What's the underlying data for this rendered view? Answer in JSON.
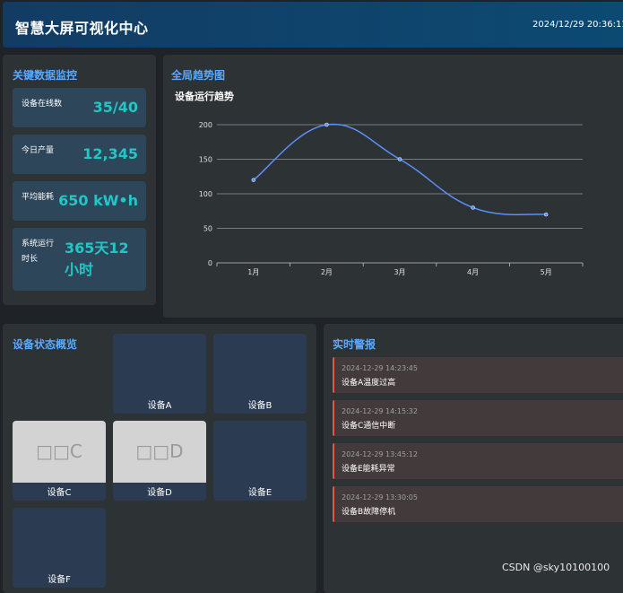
{
  "header": {
    "title": "智慧大屏可视化中心",
    "datetime": "2024/12/29 20:36:11"
  },
  "kpi": {
    "title": "关键数据监控",
    "items": [
      {
        "label": "设备在线数",
        "value": "35/40"
      },
      {
        "label": "今日产量",
        "value": "12,345"
      },
      {
        "label": "平均能耗",
        "value": "650 kW•h"
      },
      {
        "label": "系统运行时长",
        "value": "365天12小时"
      }
    ]
  },
  "trend": {
    "title": "全局趋势图",
    "chart_data": {
      "type": "line",
      "title": "设备运行趋势",
      "categories": [
        "1月",
        "2月",
        "3月",
        "4月",
        "5月"
      ],
      "values": [
        120,
        200,
        150,
        80,
        70
      ],
      "y_ticks": [
        "0",
        "50",
        "100",
        "150",
        "200"
      ],
      "ylim": [
        0,
        200
      ],
      "grid": true,
      "line_color": "#5b8ff9"
    }
  },
  "devices": {
    "title": "设备状态概览",
    "items": [
      {
        "name": "设备A",
        "thumb_text": ""
      },
      {
        "name": "设备B",
        "thumb_text": ""
      },
      {
        "name": "设备C",
        "thumb_text": "□□C"
      },
      {
        "name": "设备D",
        "thumb_text": "□□D"
      },
      {
        "name": "设备E",
        "thumb_text": ""
      },
      {
        "name": "设备F",
        "thumb_text": ""
      }
    ]
  },
  "alerts": {
    "title": "实时警报",
    "accent_color": "#e2574c",
    "items": [
      {
        "time": "2024-12-29 14:23:45",
        "message": "设备A温度过高"
      },
      {
        "time": "2024-12-29 14:15:32",
        "message": "设备C通信中断"
      },
      {
        "time": "2024-12-29 13:45:12",
        "message": "设备E能耗异常"
      },
      {
        "time": "2024-12-29 13:30:05",
        "message": "设备B故障停机"
      }
    ]
  },
  "watermark": "CSDN @sky10100100"
}
